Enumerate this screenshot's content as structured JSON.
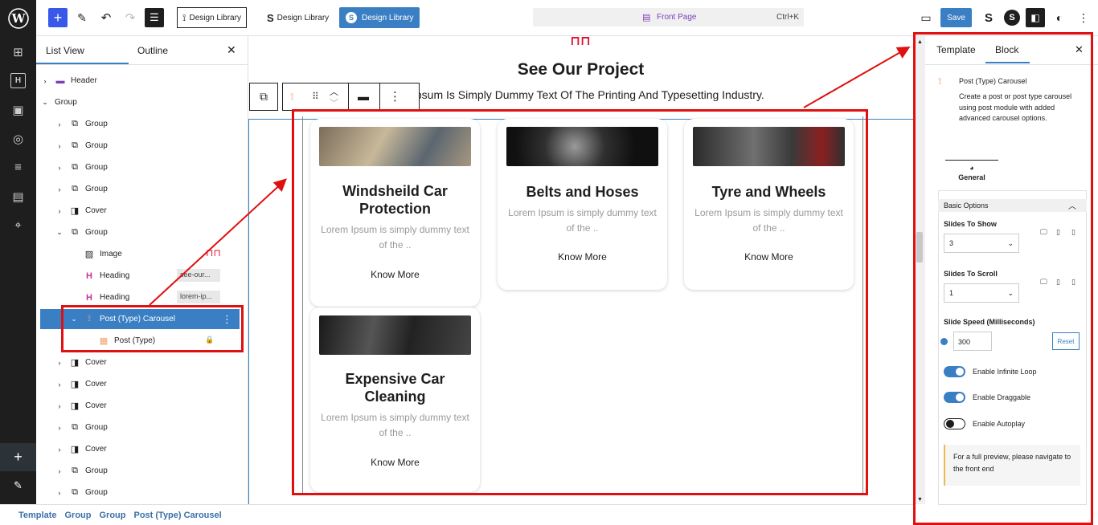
{
  "topbar": {
    "design_library_1": "Design Library",
    "design_library_2": "Design Library",
    "design_library_3": "Design Library",
    "command_title": "Front Page",
    "command_shortcut": "Ctrl+K",
    "save_label": "Save"
  },
  "listview": {
    "tab_list": "List View",
    "tab_outline": "Outline",
    "rows": [
      {
        "label": "Header",
        "icon": "header-icon",
        "indent": 0,
        "chev": "›"
      },
      {
        "label": "Group",
        "icon": "",
        "indent": 0,
        "chev": "⌄"
      },
      {
        "label": "Group",
        "icon": "group-icon",
        "indent": 1,
        "chev": "›"
      },
      {
        "label": "Group",
        "icon": "group-icon",
        "indent": 1,
        "chev": "›"
      },
      {
        "label": "Group",
        "icon": "group-icon",
        "indent": 1,
        "chev": "›"
      },
      {
        "label": "Group",
        "icon": "group-icon",
        "indent": 1,
        "chev": "›"
      },
      {
        "label": "Cover",
        "icon": "cover-icon",
        "indent": 1,
        "chev": "›"
      },
      {
        "label": "Group",
        "icon": "group-icon",
        "indent": 1,
        "chev": "⌄"
      },
      {
        "label": "Image",
        "icon": "image-icon",
        "indent": 2,
        "chev": ""
      },
      {
        "label": "Heading",
        "icon": "heading-icon",
        "indent": 2,
        "chev": "",
        "tag": "see-our..."
      },
      {
        "label": "Heading",
        "icon": "heading-icon",
        "indent": 2,
        "chev": "",
        "tag": "lorem-ip..."
      },
      {
        "label": "Post (Type) Carousel",
        "icon": "carousel-icon",
        "indent": 2,
        "chev": "⌄",
        "selected": true
      },
      {
        "label": "Post (Type)",
        "icon": "post-type-icon",
        "indent": 3,
        "chev": "",
        "locked": true
      },
      {
        "label": "Cover",
        "icon": "cover-icon",
        "indent": 1,
        "chev": "›"
      },
      {
        "label": "Cover",
        "icon": "cover-icon",
        "indent": 1,
        "chev": "›"
      },
      {
        "label": "Cover",
        "icon": "cover-icon",
        "indent": 1,
        "chev": "›"
      },
      {
        "label": "Group",
        "icon": "group-icon",
        "indent": 1,
        "chev": "›"
      },
      {
        "label": "Cover",
        "icon": "cover-icon",
        "indent": 1,
        "chev": "›"
      },
      {
        "label": "Group",
        "icon": "group-icon",
        "indent": 1,
        "chev": "›"
      },
      {
        "label": "Group",
        "icon": "group-icon",
        "indent": 1,
        "chev": "›"
      }
    ]
  },
  "breadcrumb": [
    "Template",
    "Group",
    "Group",
    "Post (Type) Carousel"
  ],
  "canvas": {
    "heading": "See Our Project",
    "subheading": "Ipsum Is Simply Dummy Text Of The Printing And Typesetting Industry.",
    "cards": [
      {
        "title": "Windsheild Car Protection",
        "text": "Lorem Ipsum is simply dummy text of the ..",
        "link": "Know More"
      },
      {
        "title": "Belts and Hoses",
        "text": "Lorem Ipsum is simply dummy text of the ..",
        "link": "Know More"
      },
      {
        "title": "Tyre and Wheels",
        "text": "Lorem Ipsum is simply dummy text of the ..",
        "link": "Know More"
      },
      {
        "title": "Expensive Car Cleaning",
        "text": "Lorem Ipsum is simply dummy text of the ..",
        "link": "Know More"
      }
    ]
  },
  "sidebar": {
    "tab_template": "Template",
    "tab_block": "Block",
    "block_name": "Post (Type) Carousel",
    "block_desc": "Create a post or post type carousel using post module with added advanced carousel options.",
    "general_tab": "General",
    "basic_options": "Basic Options",
    "slides_to_show_label": "Slides To Show",
    "slides_to_show_value": "3",
    "slides_to_scroll_label": "Slides To Scroll",
    "slides_to_scroll_value": "1",
    "slide_speed_label": "Slide Speed (Milliseconds)",
    "slide_speed_value": "300",
    "reset_label": "Reset",
    "infinite_loop_label": "Enable Infinite Loop",
    "infinite_loop_on": true,
    "draggable_label": "Enable Draggable",
    "draggable_on": true,
    "autoplay_label": "Enable Autoplay",
    "autoplay_on": false,
    "notice": "For a full preview, please navigate to the front end"
  },
  "colors": {
    "accent": "#3a7fc4",
    "annotation": "#e01010",
    "heading_icon": "#c0359b"
  }
}
